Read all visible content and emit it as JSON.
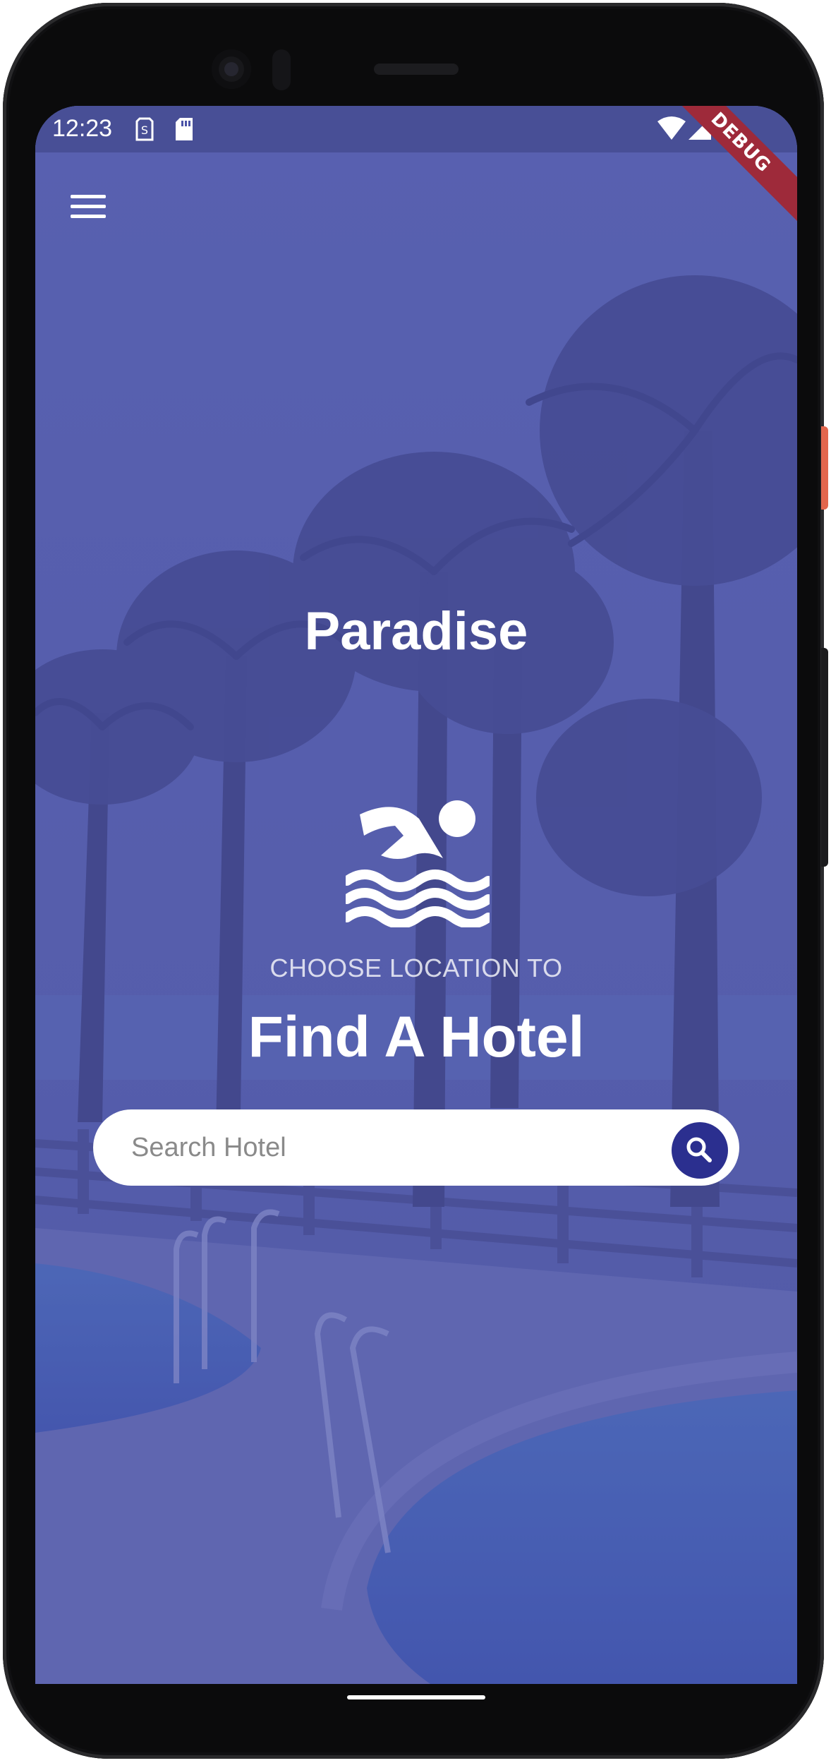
{
  "status_bar": {
    "time": "12:23",
    "icons": [
      "sim-alert-icon",
      "sd-card-icon",
      "wifi-icon",
      "signal-icon",
      "battery-icon"
    ],
    "debug_label": "DEBUG"
  },
  "app_bar": {
    "menu_icon": "hamburger-menu-icon"
  },
  "hero": {
    "title": "Paradise",
    "icon": "swimming-icon",
    "subtitle": "CHOOSE LOCATION TO",
    "headline": "Find A Hotel"
  },
  "search": {
    "placeholder": "Search Hotel",
    "value": "",
    "button_icon": "search-icon"
  },
  "colors": {
    "overlay": "#5a62ad",
    "accent": "#2b2f8f",
    "debug_banner": "#9e2a3a",
    "side_button": "#e2664d"
  }
}
